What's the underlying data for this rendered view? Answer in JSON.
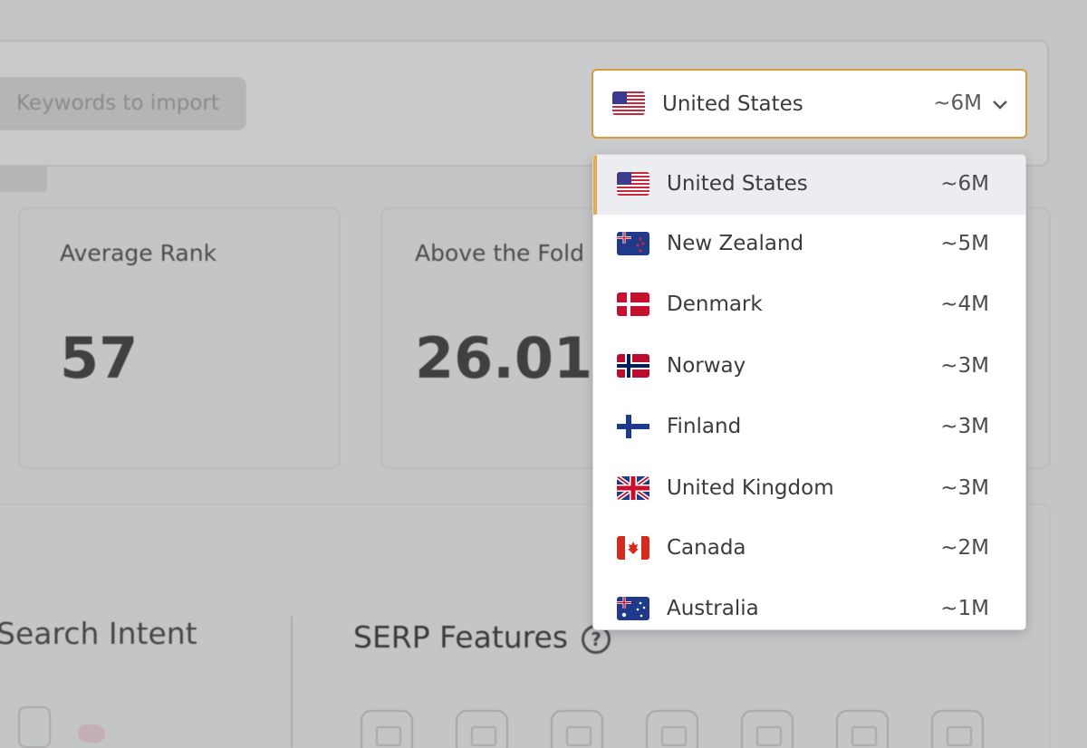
{
  "import": {
    "label": "Keywords to import"
  },
  "country_select": {
    "selected_name": "United States",
    "selected_value": "~6M",
    "selected_flag": "us-flag-icon"
  },
  "cards": [
    {
      "title": "Average Rank",
      "value": "57"
    },
    {
      "title": "Above the Fold",
      "value": "26.01K"
    }
  ],
  "sections": {
    "search_intent": "Search Intent",
    "serp_features": "SERP Features",
    "help": "?"
  },
  "dropdown": {
    "options": [
      {
        "name": "United States",
        "value": "~6M",
        "flag": "us-flag-icon",
        "selected": true
      },
      {
        "name": "New Zealand",
        "value": "~5M",
        "flag": "nz-flag-icon"
      },
      {
        "name": "Denmark",
        "value": "~4M",
        "flag": "dk-flag-icon"
      },
      {
        "name": "Norway",
        "value": "~3M",
        "flag": "no-flag-icon"
      },
      {
        "name": "Finland",
        "value": "~3M",
        "flag": "fi-flag-icon"
      },
      {
        "name": "United Kingdom",
        "value": "~3M",
        "flag": "gb-flag-icon"
      },
      {
        "name": "Canada",
        "value": "~2M",
        "flag": "ca-flag-icon"
      },
      {
        "name": "Australia",
        "value": "~1M",
        "flag": "au-flag-icon"
      }
    ]
  },
  "colors": {
    "accent": "#d79b3a",
    "selected_row": "#ecedf0",
    "overlay": "#c4c5c7"
  }
}
